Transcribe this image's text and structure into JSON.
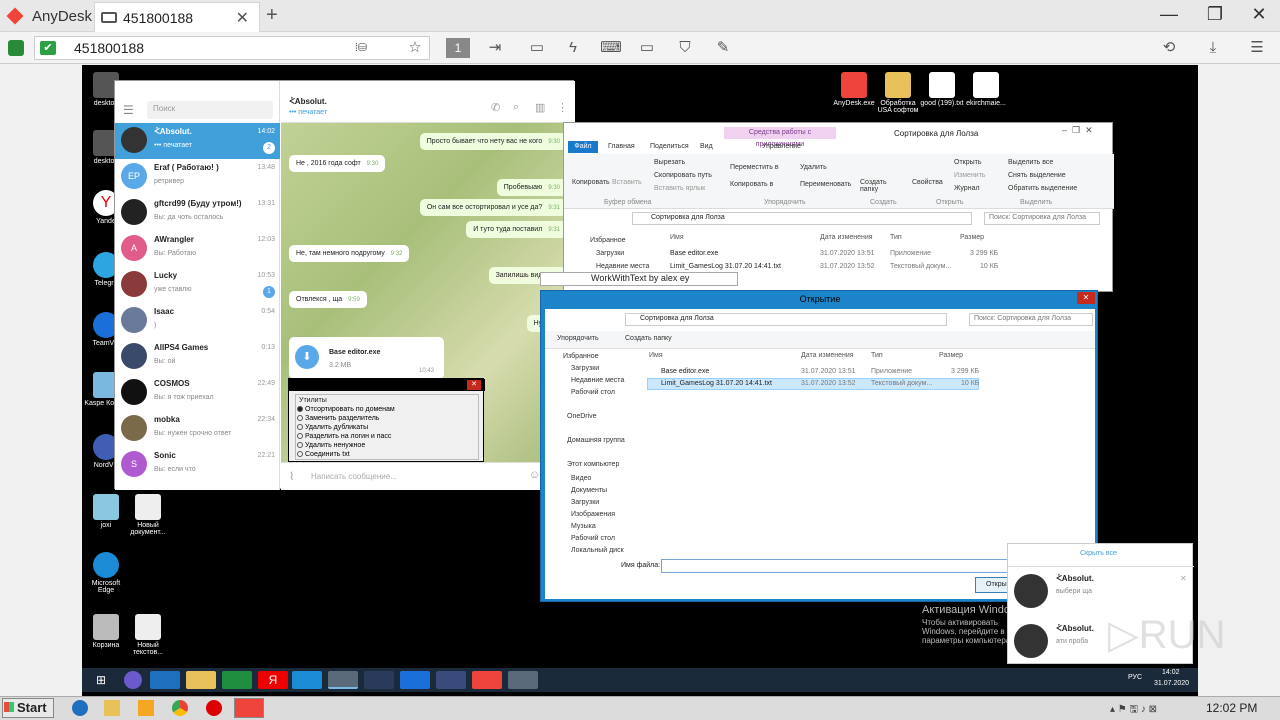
{
  "anydesk": {
    "app_name": "AnyDesk",
    "tab_label": "451800188",
    "address": "451800188",
    "accent": "#ef443b"
  },
  "remote": {
    "desktop_icons": [
      {
        "label": "desktop"
      },
      {
        "label": "desktop"
      },
      {
        "label": "Yande"
      },
      {
        "label": "Telegra"
      },
      {
        "label": "TeamVie"
      },
      {
        "label": "Kaspe Конфи"
      },
      {
        "label": "NordVP"
      },
      {
        "label": "joxi"
      },
      {
        "label": "Новый документ..."
      },
      {
        "label": "Microsoft Edge"
      },
      {
        "label": "Корзина"
      },
      {
        "label": "Новый текстов..."
      },
      {
        "label": "AnyDesk.exe"
      },
      {
        "label": "Обработка USA софтом"
      },
      {
        "label": "good (199).txt"
      },
      {
        "label": "ekirchmaie..."
      }
    ],
    "telegram": {
      "search_placeholder": "Поиск",
      "chat_title": "ᢵAbsolut.",
      "chat_status": "••• печатает",
      "chats": [
        {
          "name": "ᢵAbsolut.",
          "preview": "••• печатает",
          "time": "14:02",
          "badge": "2",
          "avatar": "",
          "color": "#333"
        },
        {
          "name": "Eraf ( Работаю! )",
          "preview": "ретривер",
          "time": "13:48",
          "badge": "",
          "avatar": "EP",
          "color": "#5aa8e8"
        },
        {
          "name": "gftcrd99 (Буду утром!)",
          "preview": "Вы: да чоть осталось",
          "time": "13:31",
          "badge": "",
          "avatar": "",
          "color": "#222"
        },
        {
          "name": "AWrangler",
          "preview": "Вы: Работаю",
          "time": "12:03",
          "badge": "",
          "avatar": "A",
          "color": "#e05c8a"
        },
        {
          "name": "Lucky",
          "preview": "уже ставлю",
          "time": "10:53",
          "badge": "1",
          "avatar": "",
          "color": "#8a3a3a"
        },
        {
          "name": "Isaac",
          "preview": ")",
          "time": "0:54",
          "badge": "",
          "avatar": "",
          "color": "#6a7a9a"
        },
        {
          "name": "AllPS4 Games",
          "preview": "Вы: ой",
          "time": "0:13",
          "badge": "",
          "avatar": "",
          "color": "#3a4a6a"
        },
        {
          "name": "COSMOS",
          "preview": "Вы: я тож приехал",
          "time": "22:49",
          "badge": "",
          "avatar": "",
          "color": "#111"
        },
        {
          "name": "mobka",
          "preview": "Вы: нужен срочно ответ",
          "time": "22:34",
          "badge": "",
          "avatar": "",
          "color": "#7a6a4a"
        },
        {
          "name": "Sonic",
          "preview": "Вы: если что",
          "time": "22:21",
          "badge": "",
          "avatar": "S",
          "color": "#b05ad0"
        }
      ],
      "messages": [
        {
          "text": "Просто бывает что нету вас не кого",
          "time": "9:30",
          "out": true
        },
        {
          "text": "Не , 2016 года софт",
          "time": "9:30",
          "out": false
        },
        {
          "text": "Пробевыаю",
          "time": "9:30",
          "out": true
        },
        {
          "text": "Он сам всe остортировал и усе да?",
          "time": "9:31",
          "out": true
        },
        {
          "text": "И туто туда поставил",
          "time": "9:31",
          "out": true
        },
        {
          "text": "Не, там немного подругому",
          "time": "9:32",
          "out": false
        },
        {
          "text": "Запилишь видео?",
          "time": "",
          "out": true
        },
        {
          "text": "Отвлекся , ща",
          "time": "9:59",
          "out": false
        },
        {
          "text": "Ну чо)",
          "time": "",
          "out": true
        }
      ],
      "file_name": "Base editor.exe",
      "file_size": "3.2 MB",
      "file_time": "10:43",
      "input_placeholder": "Написать сообщение..."
    },
    "util_dialog": {
      "group": "Утилиты",
      "options": [
        "Отсортировать по доменам",
        "Заменить разделитель",
        "Удалить дубликаты",
        "Разделить на логин и пасс",
        "Удалить ненужное",
        "Соединить txt"
      ]
    },
    "explorer": {
      "context_tab": "Средства работы с приложениями",
      "title": "Сортировка для Лолза",
      "tabs": [
        "Файл",
        "Главная",
        "Поделиться",
        "Вид",
        "Управление"
      ],
      "ribbon": [
        "Копировать",
        "Вставить",
        "Вырезать",
        "Скопировать путь",
        "Вставить ярлык",
        "Переместить в",
        "Копировать в",
        "Удалить",
        "Переименовать",
        "Создать папку",
        "Свойства",
        "Открыть",
        "Изменить",
        "Журнал",
        "Выделить все",
        "Снять выделение",
        "Обратить выделение"
      ],
      "groups": [
        "Буфер обмена",
        "Упорядочить",
        "Создать",
        "Открыть",
        "Выделить"
      ],
      "path": "Сортировка для Лолза",
      "search": "Поиск: Сортировка для Лолза",
      "nav": [
        "Избранное",
        "Загрузки",
        "Недавние места"
      ],
      "columns": [
        "Имя",
        "Дата изменения",
        "Тип",
        "Размер"
      ],
      "files": [
        {
          "name": "Base editor.exe",
          "date": "31.07.2020 13:51",
          "type": "Приложение",
          "size": "3 299 КБ"
        },
        {
          "name": "Limit_GamesLog 31.07.20 14:41.txt",
          "date": "31.07.2020 13:52",
          "type": "Текстовый докум...",
          "size": "10 КБ"
        }
      ]
    },
    "wwt_title": "WorkWithText by alex ey",
    "open_dialog": {
      "title": "Открытие",
      "path": "Сортировка для Лолза",
      "search": "Поиск: Сортировка для Лолза",
      "organize": "Упорядочить",
      "new_folder": "Создать папку",
      "nav": [
        "Избранное",
        "Загрузки",
        "Недавние места",
        "Рабочий стол",
        "OneDrive",
        "Домашняя группа",
        "Этот компьютер",
        "Видео",
        "Документы",
        "Загрузки",
        "Изображения",
        "Музыка",
        "Рабочий стол",
        "Локальный диск"
      ],
      "columns": [
        "Имя",
        "Дата изменения",
        "Тип",
        "Размер"
      ],
      "files": [
        {
          "name": "Base editor.exe",
          "date": "31.07.2020 13:51",
          "type": "Приложение",
          "size": "3 299 КБ"
        },
        {
          "name": "Limit_GamesLog 31.07.20 14:41.txt",
          "date": "31.07.2020 13:52",
          "type": "Текстовый докум...",
          "size": "10 КБ"
        }
      ],
      "filename_label": "Имя файла:",
      "open_button": "Откры"
    },
    "notifications": {
      "hide_all": "Скрыть все",
      "items": [
        {
          "name": "ᢵAbsolut.",
          "text": "выбери ща"
        },
        {
          "name": "ᢵAbsolut.",
          "text": "ати проба"
        }
      ]
    },
    "activation": {
      "title": "Активация Windows",
      "text": "Чтобы активировать Windows, перейдите в параметры компьютера."
    },
    "tray": {
      "lang": "РУС",
      "time": "14:02",
      "date": "31.07.2020"
    }
  },
  "host_taskbar": {
    "start": "Start",
    "time": "12:02 PM"
  }
}
